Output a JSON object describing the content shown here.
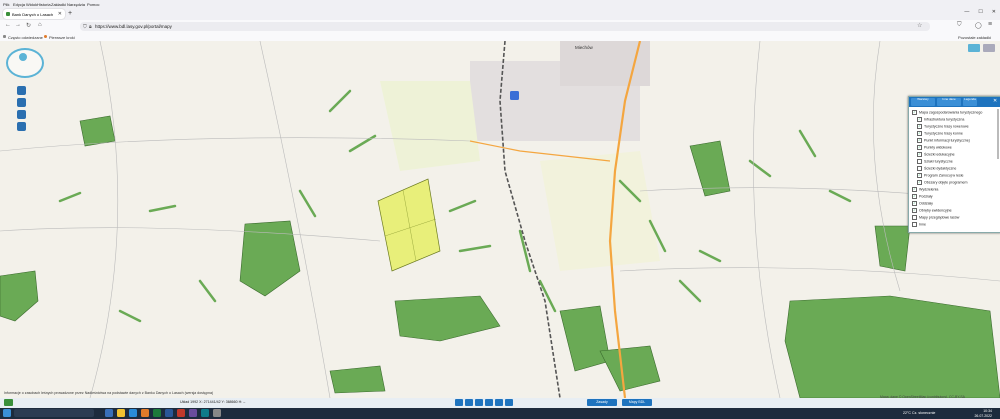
{
  "browser": {
    "menu": [
      "Plik",
      "Edycja",
      "Widok",
      "Historia",
      "Zakładki",
      "Narzędzia",
      "Pomoc"
    ],
    "tab_title": "Bank Danych o Lasach",
    "url": "https://www.bdl.lasy.gov.pl/portal/mapy",
    "bookmarks": [
      "Często odwiedzane",
      "Pierwsze kroki"
    ],
    "other_bookmarks": "Pozostałe zakładki"
  },
  "map": {
    "town_label": "Miechów",
    "attribution": "Mapa: dane © OpenStreetMap (contributors), CC-BY-SA",
    "footer_info": "Informacje o zasobach leśnych prowadzone przez Nadleśnictwa na podstawie danych z Banku Danych o Lasach (wersja dostępna)",
    "coordinates": "Układ 1992 X: 271441/42 Y: 368660 H: –",
    "forest_color": "#6aaa55",
    "selection_color": "#e8ef7a",
    "road_color": "#f4a640",
    "rail_color": "#555555"
  },
  "layer_panel": {
    "header_buttons": [
      "Warstwy",
      "Inne dane",
      "Legenda"
    ],
    "layers": [
      {
        "label": "Mapa zagospodarowania turystycznego",
        "checked": true
      },
      {
        "label": "Infrastruktura turystyczna",
        "checked": true
      },
      {
        "label": "Turystyczne trasy rowerowe",
        "checked": true
      },
      {
        "label": "Turystyczne trasy konne",
        "checked": true
      },
      {
        "label": "Punkt informacji turystycznej",
        "checked": true
      },
      {
        "label": "Punkty widokowe",
        "checked": true
      },
      {
        "label": "Ścieżki edukacyjne",
        "checked": true
      },
      {
        "label": "Szlaki turystyczne",
        "checked": false
      },
      {
        "label": "Ścieżki dydaktyczne",
        "checked": false
      },
      {
        "label": "Program Zanocuj w lesie",
        "checked": true
      },
      {
        "label": "Obszary objęte programem",
        "checked": true
      },
      {
        "label": "Wydzielenia",
        "checked": true
      },
      {
        "label": "Podziały",
        "checked": true
      },
      {
        "label": "Oddziały",
        "checked": true
      },
      {
        "label": "Obręby ewidencyjne",
        "checked": true
      },
      {
        "label": "Mapy przeglądowe lasów",
        "checked": false
      },
      {
        "label": "Inne",
        "checked": false
      }
    ]
  },
  "footer_buttons": [
    "Zasady",
    "Mapy BDL"
  ],
  "taskbar": {
    "weather": "22°C Cz. słonecznie",
    "time": "10:34",
    "date": "26.07.2022"
  }
}
